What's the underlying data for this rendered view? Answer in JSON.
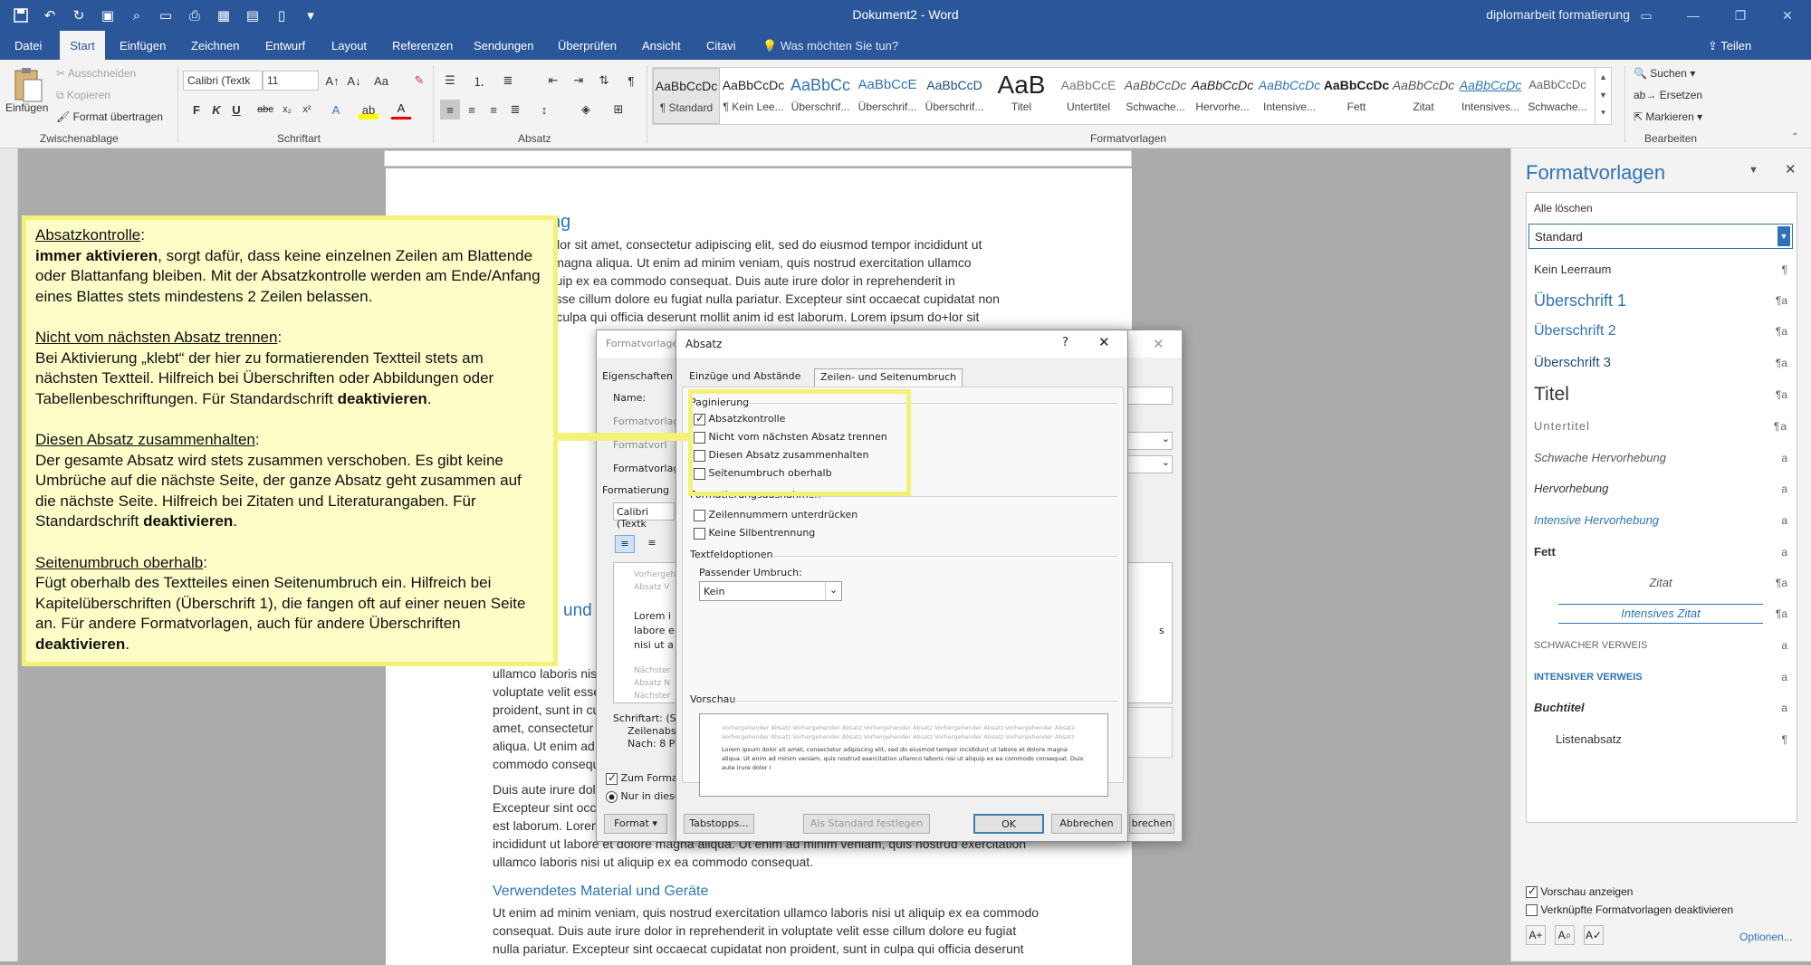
{
  "window": {
    "title": "Dokument2 - Word",
    "account": "diplomarbeit formatierung"
  },
  "menu": {
    "tabs": [
      "Datei",
      "Start",
      "Einfügen",
      "Zeichnen",
      "Entwurf",
      "Layout",
      "Referenzen",
      "Sendungen",
      "Überprüfen",
      "Ansicht",
      "Citavi"
    ],
    "tell_me": "Was möchten Sie tun?",
    "share": "Teilen"
  },
  "ribbon": {
    "clipboard": {
      "paste": "Einfügen",
      "cut": "Ausschneiden",
      "copy": "Kopieren",
      "format_painter": "Format übertragen",
      "label": "Zwischenablage"
    },
    "font": {
      "name": "Calibri (Textk",
      "size": "11",
      "label": "Schriftart"
    },
    "paragraph": {
      "label": "Absatz"
    },
    "styles": {
      "label": "Formatvorlagen",
      "items": [
        {
          "preview": "AaBbCcDc",
          "name": "¶ Standard"
        },
        {
          "preview": "AaBbCcDc",
          "name": "¶ Kein Lee..."
        },
        {
          "preview": "AaBbCc",
          "name": "Überschrif..."
        },
        {
          "preview": "AaBbCcE",
          "name": "Überschrif..."
        },
        {
          "preview": "AaBbCcD",
          "name": "Überschrif..."
        },
        {
          "preview": "AaB",
          "name": "Titel"
        },
        {
          "preview": "AaBbCcE",
          "name": "Untertitel"
        },
        {
          "preview": "AaBbCcDc",
          "name": "Schwache..."
        },
        {
          "preview": "AaBbCcDc",
          "name": "Hervorhe..."
        },
        {
          "preview": "AaBbCcDc",
          "name": "Intensive..."
        },
        {
          "preview": "AaBbCcDc",
          "name": "Fett"
        },
        {
          "preview": "AaBbCcDc",
          "name": "Zitat"
        },
        {
          "preview": "AaBbCcDc",
          "name": "Intensives..."
        },
        {
          "preview": "AaBbCcDc",
          "name": "Schwache..."
        }
      ]
    },
    "editing": {
      "find": "Suchen",
      "replace": "Ersetzen",
      "select": "Markieren",
      "label": "Bearbeiten"
    }
  },
  "document": {
    "heading1": "ng",
    "lines1": [
      "m dolor sit amet, consectetur adipiscing elit, sed do eiusmod tempor incididunt ut",
      "lore magna aliqua. Ut enim ad minim veniam, quis nostrud exercitation ullamco",
      "t aliquip ex ea commodo consequat. Duis aute irure dolor in reprehenderit in",
      "elit esse cillum dolore eu fugiat nulla pariatur. Excepteur sint occaecat cupidatat non",
      "nt in culpa qui officia deserunt mollit anim id est laborum. Lorem ipsum do+lor sit"
    ],
    "heading2": "und",
    "lines2": [
      "ullamco laboris nisi",
      "voluptate velit esse",
      "proident, sunt in cu",
      "amet, consectetur",
      "aliqua. Ut enim ad",
      "commodo consequ"
    ],
    "lines3": [
      "Duis aute irure dolo",
      "Excepteur sint occa",
      "est laborum. Lorem",
      "incididunt ut labore et dolore magna aliqua. Ut enim ad minim veniam, quis nostrud exercitation",
      "ullamco laboris nisi ut aliquip ex ea commodo consequat."
    ],
    "heading3": "Verwendetes Material und Geräte",
    "lines4": [
      "Ut enim ad minim veniam, quis nostrud exercitation ullamco laboris nisi ut aliquip ex ea commodo",
      "consequat. Duis aute irure dolor in reprehenderit in voluptate velit esse cillum dolore eu fugiat",
      "nulla pariatur. Excepteur sint occaecat cupidatat non proident, sunt in culpa qui officia deserunt"
    ]
  },
  "callout": {
    "h1": "Absatzkontrolle",
    "b1": "immer aktivieren",
    "t1": ", sorgt dafür, dass keine einzelnen Zeilen am Blattende oder Blattanfang bleiben. Mit der Absatzkontrolle werden am Ende/Anfang eines Blattes stets mindestens 2 Zeilen belassen.",
    "h2": "Nicht vom nächsten Absatz trennen",
    "t2": "Bei Aktivierung „klebt“ der hier zu formatierenden Textteil stets am nächsten Textteil. Hilfreich bei Überschriften oder Abbildungen oder Tabellenbeschriftungen. Für Standardschrift ",
    "b2": "deaktivieren",
    "h3": "Diesen Absatz zusammenhalten",
    "t3": "Der gesamte Absatz wird stets zusammen verschoben. Es gibt keine Umbrüche auf die nächste Seite, der ganze Absatz geht zusammen auf die nächste Seite. Hilfreich bei Zitaten und Literaturangaben. Für Standardschrift ",
    "b3": "deaktivieren",
    "h4": "Seitenumbruch oberhalb",
    "t4": "Fügt oberhalb des Textteiles einen Seitenumbruch ein. Hilfreich bei Kapitelüberschriften (Überschrift 1), die fangen oft auf einer neuen Seite an. Für andere Formatvorlagen, auch für andere Überschriften ",
    "b4": "deaktivieren",
    "colon": ":",
    "period": "."
  },
  "back_dialog": {
    "title": "Formatvorlage",
    "properties": "Eigenschaften",
    "name": "Name:",
    "type": "Formatvorlag",
    "based": "Formatvorl",
    "next": "Formatvorlag",
    "formatting": "Formatierung",
    "font": "Calibri (Textk",
    "preview1": "Vorhergeh",
    "preview2": "Absatz V",
    "lorem": [
      "Lorem i",
      "labore e",
      "nisi ut a"
    ],
    "next1": "Nächster",
    "next2": "Absatz N",
    "next3": "Nächster",
    "font_desc": "Schriftart: (St",
    "spacing": "Zeilenabst",
    "after": "Nach:  8 Pt",
    "add_gallery": "Zum Format",
    "only_doc": "Nur in diese",
    "format_btn": "Format",
    "cancel": "brechen",
    "side_s": "s"
  },
  "dialog": {
    "title": "Absatz",
    "help": "?",
    "tabs": [
      "Einzüge und Abstände",
      "Zeilen- und Seitenumbruch"
    ],
    "pagination": "Paginierung",
    "checks": [
      {
        "label": "Absatzkontrolle",
        "on": true
      },
      {
        "label": "Nicht vom nächsten Absatz trennen",
        "on": false
      },
      {
        "label": "Diesen Absatz zusammenhalten",
        "on": false
      },
      {
        "label": "Seitenumbruch oberhalb",
        "on": false
      }
    ],
    "exceptions": "Formatierungsausnahmen",
    "checks2": [
      {
        "label": "Zeilennummern unterdrücken",
        "on": false
      },
      {
        "label": "Keine Silbentrennung",
        "on": false
      }
    ],
    "textbox": "Textfeldoptionen",
    "wrap_label": "Passender Umbruch:",
    "wrap_value": "Kein",
    "preview_label": "Vorschau",
    "preview_prev": "Vorhergehender Absatz Vorhergehender Absatz Vorhergehender Absatz Vorhergehender Absatz Vorhergehender Absatz Vorhergehender Absatz Vorhergehender Absatz Vorhergehender Absatz Vorhergehender Absatz Vorhergehender Absatz",
    "preview_text": "Lorem ipsum dolor sit amet, consectetur adipiscing elit, sed do eiusmod tempor incididunt ut labore et dolore magna aliqua. Ut enim ad minim veniam, quis nostrud exercitation ullamco laboris nisi ut aliquip ex ea commodo consequat. Duis aute irure dolor i",
    "tabstops": "Tabstopps...",
    "default": "Als Standard festlegen",
    "ok": "OK",
    "cancel": "Abbrechen"
  },
  "pane": {
    "title": "Formatvorlagen",
    "clear_all": "Alle löschen",
    "selected": "Standard",
    "items": [
      {
        "name": "Kein Leerraum",
        "mark": "¶"
      },
      {
        "name": "Überschrift 1",
        "mark": "¶a"
      },
      {
        "name": "Überschrift 2",
        "mark": "¶a"
      },
      {
        "name": "Überschrift 3",
        "mark": "¶a"
      },
      {
        "name": "Titel",
        "mark": "¶a"
      },
      {
        "name": "Untertitel",
        "mark": "¶a"
      },
      {
        "name": "Schwache Hervorhebung",
        "mark": "a"
      },
      {
        "name": "Hervorhebung",
        "mark": "a"
      },
      {
        "name": "Intensive Hervorhebung",
        "mark": "a"
      },
      {
        "name": "Fett",
        "mark": "a"
      },
      {
        "name": "Zitat",
        "mark": "¶a"
      },
      {
        "name": "Intensives Zitat",
        "mark": "¶a"
      },
      {
        "name": "Schwacher Verweis",
        "mark": "a"
      },
      {
        "name": "Intensiver Verweis",
        "mark": "a"
      },
      {
        "name": "Buchtitel",
        "mark": "a"
      },
      {
        "name": "Listenabsatz",
        "mark": "¶"
      }
    ],
    "show_preview": "Vorschau anzeigen",
    "disable_linked": "Verknüpfte Formatvorlagen deaktivieren",
    "options": "Optionen..."
  }
}
